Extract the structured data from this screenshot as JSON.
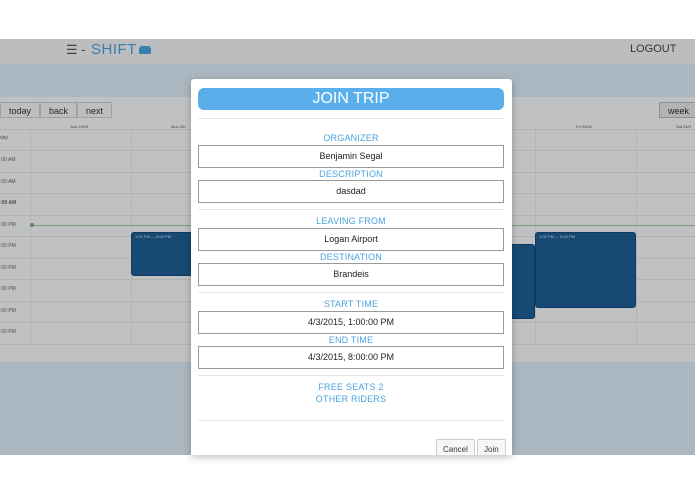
{
  "navbar": {
    "menu_icon": "☰ -",
    "brand": "SHIFT",
    "logout": "LOGOUT"
  },
  "calendar": {
    "buttons": {
      "today": "today",
      "back": "back",
      "next": "next",
      "week": "week"
    },
    "day_headers": [
      "Sun 29/03",
      "Mon 30/",
      "Fri 03/04",
      "Sat 04/0"
    ],
    "allday_label": "day",
    "time_labels": [
      ":00 AM",
      ":00 AM",
      ":00 AM",
      ":00 PM",
      ":00 PM",
      ":00 PM",
      ":00 PM",
      ":00 PM",
      ":00 PM"
    ],
    "events": [
      {
        "label": "1:00 PM — 8:00 PM"
      },
      {
        "label": "1:00 PM — 8:00 PM"
      }
    ]
  },
  "modal": {
    "title": "JOIN TRIP",
    "organizer_label": "ORGANIZER",
    "organizer_value": "Benjamin Segal",
    "description_label": "DESCRIPTION",
    "description_value": "dasdad",
    "leaving_from_label": "LEAVING FROM",
    "leaving_from_value": "Logan Airport",
    "destination_label": "DESTINATION",
    "destination_value": "Brandeis",
    "start_time_label": "START TIME",
    "start_time_value": "4/3/2015, 1:00:00 PM",
    "end_time_label": "END TIME",
    "end_time_value": "4/3/2015, 8:00:00 PM",
    "free_seats": "FREE SEATS 2",
    "other_riders": "OTHER RIDERS",
    "cancel_label": "Cancel",
    "join_label": "Join"
  },
  "colors": {
    "accent": "#4aa3df",
    "title_bg": "#5aaeea",
    "event": "#1d5f95"
  }
}
